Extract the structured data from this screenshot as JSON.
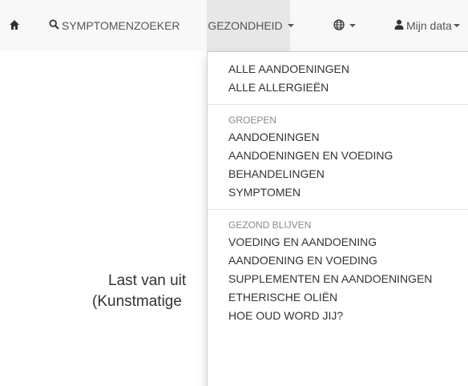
{
  "navbar": {
    "home_icon": "home-icon",
    "symptom_checker": {
      "icon": "search-icon",
      "label": "SYMPTOMENZOEKER"
    },
    "health": {
      "label": "GEZONDHEID"
    },
    "language": {
      "icon": "globe-icon"
    },
    "my_data": {
      "icon": "user-icon",
      "label": "Mijn data"
    }
  },
  "background": {
    "line1": "Last van uit",
    "line2": "(Kunstmatige"
  },
  "dropdown": {
    "top_items": [
      "ALLE AANDOENINGEN",
      "ALLE ALLERGIEËN"
    ],
    "groups": {
      "header": "GROEPEN",
      "items": [
        "AANDOENINGEN",
        "AANDOENINGEN EN VOEDING",
        "BEHANDELINGEN",
        "SYMPTOMEN"
      ]
    },
    "healthy": {
      "header": "GEZOND BLIJVEN",
      "items": [
        "VOEDING EN AANDOENING",
        "AANDOENING EN VOEDING",
        "SUPPLEMENTEN EN AANDOENINGEN",
        "ETHERISCHE OLIËN",
        "HOE OUD WORD JIJ?"
      ]
    }
  },
  "colors": {
    "navbar_bg": "#f8f8f8",
    "active_bg": "#e7e7e7",
    "text": "#333333",
    "muted": "#8a8a8a"
  }
}
